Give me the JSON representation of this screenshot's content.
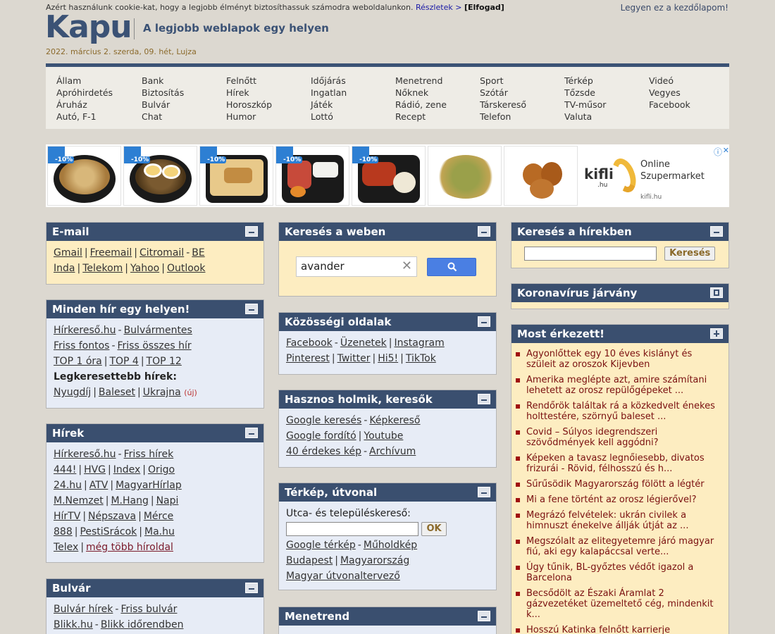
{
  "cookie": {
    "text": "Azért használunk cookie-kat, hogy a legjobb élményt biztosíthassuk számodra weboldalunkon.",
    "details": "Részletek >",
    "accept": "[Elfogad]"
  },
  "home_link": "Legyen ez a kezdőlapom!",
  "logo": "Kapu",
  "tagline": "A legjobb weblapok egy helyen",
  "date": "2022. március 2. szerda, 09. hét, Lujza",
  "nav": [
    [
      "Állam",
      "Apróhirdetés",
      "Áruház",
      "Autó, F-1"
    ],
    [
      "Bank",
      "Biztosítás",
      "Bulvár",
      "Chat"
    ],
    [
      "Felnőtt",
      "Hírek",
      "Horoszkóp",
      "Humor"
    ],
    [
      "Időjárás",
      "Ingatlan",
      "Játék",
      "Lottó"
    ],
    [
      "Menetrend",
      "Nőknek",
      "Rádió, zene",
      "Recept"
    ],
    [
      "Sport",
      "Szótár",
      "Társkereső",
      "Telefon"
    ],
    [
      "Térkép",
      "Tőzsde",
      "TV-műsor",
      "Valuta"
    ],
    [
      "Videó",
      "Vegyes",
      "Facebook"
    ]
  ],
  "ad": {
    "badge": "-10%",
    "brand": "kifli",
    "brand_tld": ".hu",
    "title_1": "Online",
    "title_2": "Szupermarket",
    "url": "kifli.hu",
    "info_icon": "info-icon",
    "close_icon": "close-icon"
  },
  "email": {
    "title": "E-mail",
    "rows": [
      [
        {
          "t": "Gmail",
          "l": true
        },
        {
          "t": "|"
        },
        {
          "t": "Freemail",
          "l": true
        },
        {
          "t": "|"
        },
        {
          "t": "Citromail",
          "l": true
        },
        {
          "t": "-"
        },
        {
          "t": "BE",
          "l": true
        }
      ],
      [
        {
          "t": "Inda",
          "l": true
        },
        {
          "t": "|"
        },
        {
          "t": "Telekom",
          "l": true
        },
        {
          "t": "|"
        },
        {
          "t": "Yahoo",
          "l": true
        },
        {
          "t": "|"
        },
        {
          "t": "Outlook",
          "l": true
        }
      ]
    ]
  },
  "minden_hir": {
    "title": "Minden hír egy helyen!",
    "rows": [
      [
        {
          "t": "Hírkereső.hu",
          "l": true
        },
        {
          "t": "-"
        },
        {
          "t": "Bulvármentes",
          "l": true
        }
      ],
      [
        {
          "t": "Friss fontos",
          "l": true
        },
        {
          "t": "-"
        },
        {
          "t": "Friss összes hír",
          "l": true
        }
      ],
      [
        {
          "t": "TOP 1 óra",
          "l": true
        },
        {
          "t": "|"
        },
        {
          "t": "TOP 4",
          "l": true
        },
        {
          "t": "|"
        },
        {
          "t": "TOP 12",
          "l": true
        }
      ],
      [
        {
          "t": "Legkeresettebb hírek:",
          "b": true
        }
      ],
      [
        {
          "t": "Nyugdíj",
          "l": true
        },
        {
          "t": "|"
        },
        {
          "t": "Baleset",
          "l": true
        },
        {
          "t": "|"
        },
        {
          "t": "Ukrajna",
          "l": true
        },
        {
          "t": "(új)",
          "u": true
        }
      ]
    ]
  },
  "hirek": {
    "title": "Hírek",
    "rows": [
      [
        {
          "t": "Hírkereső.hu",
          "l": true
        },
        {
          "t": "-"
        },
        {
          "t": "Friss hírek",
          "l": true
        }
      ],
      [
        {
          "t": "444!",
          "l": true
        },
        {
          "t": "|"
        },
        {
          "t": "HVG",
          "l": true
        },
        {
          "t": "|"
        },
        {
          "t": "Index",
          "l": true
        },
        {
          "t": "|"
        },
        {
          "t": "Origo",
          "l": true
        }
      ],
      [
        {
          "t": "24.hu",
          "l": true
        },
        {
          "t": "|"
        },
        {
          "t": "ATV",
          "l": true
        },
        {
          "t": "|"
        },
        {
          "t": "MagyarHírlap",
          "l": true
        }
      ],
      [
        {
          "t": "M.Nemzet",
          "l": true
        },
        {
          "t": "|"
        },
        {
          "t": "M.Hang",
          "l": true
        },
        {
          "t": "|"
        },
        {
          "t": "Napi",
          "l": true
        }
      ],
      [
        {
          "t": "HírTV",
          "l": true
        },
        {
          "t": "|"
        },
        {
          "t": "Népszava",
          "l": true
        },
        {
          "t": "|"
        },
        {
          "t": "Mérce",
          "l": true
        }
      ],
      [
        {
          "t": "888",
          "l": true
        },
        {
          "t": "|"
        },
        {
          "t": "PestiSrácok",
          "l": true
        },
        {
          "t": "|"
        },
        {
          "t": "Ma.hu",
          "l": true
        }
      ],
      [
        {
          "t": "Telex",
          "l": true
        },
        {
          "t": "|"
        },
        {
          "t": "még több híroldal",
          "l": true,
          "m": true
        }
      ]
    ]
  },
  "bulvar": {
    "title": "Bulvár",
    "rows": [
      [
        {
          "t": "Bulvár hírek",
          "l": true
        },
        {
          "t": "-"
        },
        {
          "t": "Friss bulvár",
          "l": true
        }
      ],
      [
        {
          "t": "Blikk.hu",
          "l": true
        },
        {
          "t": "-"
        },
        {
          "t": "Blikk időrendben",
          "l": true
        }
      ]
    ]
  },
  "web_search": {
    "title": "Keresés a weben",
    "value": "avander"
  },
  "kozossegi": {
    "title": "Közösségi oldalak",
    "rows": [
      [
        {
          "t": "Facebook",
          "l": true
        },
        {
          "t": "-"
        },
        {
          "t": "Üzenetek",
          "l": true
        },
        {
          "t": "|"
        },
        {
          "t": "Instagram",
          "l": true
        }
      ],
      [
        {
          "t": "Pinterest",
          "l": true
        },
        {
          "t": "|"
        },
        {
          "t": "Twitter",
          "l": true
        },
        {
          "t": "|"
        },
        {
          "t": "Hi5!",
          "l": true
        },
        {
          "t": "|"
        },
        {
          "t": "TikTok",
          "l": true
        }
      ]
    ]
  },
  "hasznos": {
    "title": "Hasznos holmik, keresők",
    "rows": [
      [
        {
          "t": "Google keresés",
          "l": true
        },
        {
          "t": "-"
        },
        {
          "t": "Képkereső",
          "l": true
        }
      ],
      [
        {
          "t": "Google fordító",
          "l": true
        },
        {
          "t": "|"
        },
        {
          "t": "Youtube",
          "l": true
        }
      ],
      [
        {
          "t": "40 érdekes kép",
          "l": true
        },
        {
          "t": "-"
        },
        {
          "t": "Archívum",
          "l": true
        }
      ]
    ]
  },
  "terkep": {
    "title": "Térkép, útvonal",
    "label": "Utca- és településkereső:",
    "ok": "OK",
    "rows": [
      [
        {
          "t": "Google térkép",
          "l": true
        },
        {
          "t": "-"
        },
        {
          "t": "Műholdkép",
          "l": true
        }
      ],
      [
        {
          "t": "Budapest",
          "l": true
        },
        {
          "t": "|"
        },
        {
          "t": "Magyarország",
          "l": true
        }
      ],
      [
        {
          "t": "Magyar útvonaltervező",
          "l": true
        }
      ]
    ]
  },
  "menetrend": {
    "title": "Menetrend"
  },
  "hir_search": {
    "title": "Keresés a hírekben",
    "button": "Keresés"
  },
  "korona": {
    "title": "Koronavírus járvány"
  },
  "most": {
    "title": "Most érkezett!",
    "items": [
      "Agyonlőttek egy 10 éves kislányt és szüleit az oroszok Kijevben",
      "Amerika megléptе azt, amire számítani lehetett az orosz repülőgépeket ...",
      "Rendőrök találtak rá a közkedvelt énekes holttestére, szörnyű baleset ...",
      "Covid – Súlyos idegrendszeri szövődmények kell aggódni?",
      "Képeken a tavasz legnőiesebb, divatos frizurái - Rövid, félhosszú és h...",
      "Sűrűsödik Magyarország fölött a légtér",
      "Mi a fene történt az orosz légierővel?",
      "Megrázó felvételek: ukrán civilek a himnuszt énekelve állják útját az ...",
      "Megszólalt az elitegyetemre járó magyar fiú, aki egy kalapáccsal verte...",
      "Úgy tűnik, BL-győztes védőt igazol a Barcelona",
      "Becsődölt az Északi Áramlat 2 gázvezetéket üzemeltető cég, mindenkit k...",
      "Hosszú Katinka felnőtt karrierje"
    ]
  }
}
